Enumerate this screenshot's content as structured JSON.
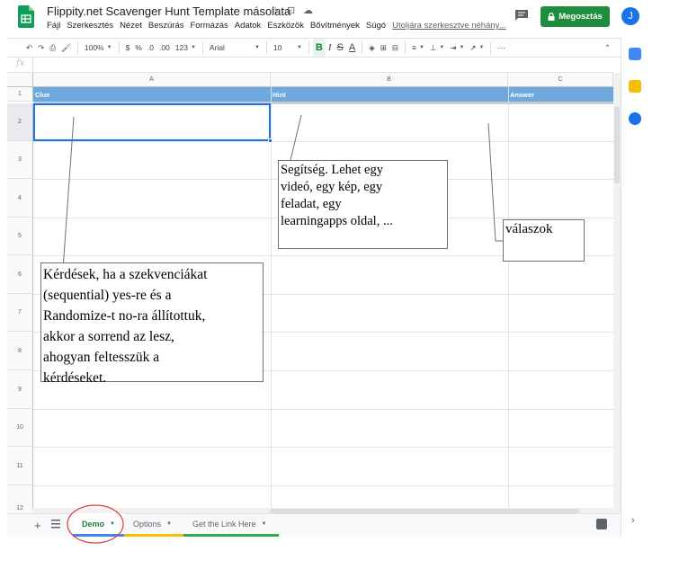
{
  "app": {
    "doc_title": "Flippity.net Scavenger Hunt Template másolata",
    "menu": [
      "Fájl",
      "Szerkesztés",
      "Nézet",
      "Beszúrás",
      "Formázás",
      "Adatok",
      "Eszközök",
      "Bővítmények",
      "Súgó"
    ],
    "last_edit": "Utoljára szerkesztve néhány...",
    "share_label": "Megosztás",
    "avatar_letter": "J"
  },
  "toolbar": {
    "zoom": "100%",
    "currency": "$",
    "percent": "%",
    "decimal_less": ".0",
    "decimal_more": ".00",
    "more_formats": "123",
    "font": "Arial",
    "font_size": "10",
    "bold": "B",
    "italic": "I",
    "strike": "S",
    "text_color": "A",
    "more": "⋯"
  },
  "formula_bar": {
    "fx": "fx",
    "value": ""
  },
  "grid": {
    "columns": [
      "A",
      "B",
      "C"
    ],
    "rows": [
      "1",
      "2",
      "3",
      "4",
      "5",
      "6",
      "7",
      "8",
      "9",
      "10",
      "11",
      "12"
    ],
    "header_row": [
      "Clue",
      "Hint",
      "Answer"
    ],
    "header_color": "#6fa8dc",
    "selected_cell": "A2"
  },
  "notes": {
    "hint": "Segítség. Lehet egy\nvideó, egy kép, egy\nfeladat, egy\nlearningapps oldal, ...",
    "answer": "válaszok",
    "clue": "Kérdések, ha a szekvenciákat\n(sequential) yes-re és a\nRandomize-t no-ra állítottuk,\nakkor a sorrend az lesz,\nahogyan feltesszük a\nkérdéseket."
  },
  "sheets": [
    {
      "label": "Demo",
      "color": "#4285f4",
      "active": true
    },
    {
      "label": "Options",
      "color": "#fbbc04",
      "active": false
    },
    {
      "label": "Get the Link Here",
      "color": "#34a853",
      "active": false
    }
  ],
  "colors": {
    "brand_green": "#1e8e3e",
    "accent_blue": "#1a73e8",
    "highlight_circle": "#e53935"
  }
}
